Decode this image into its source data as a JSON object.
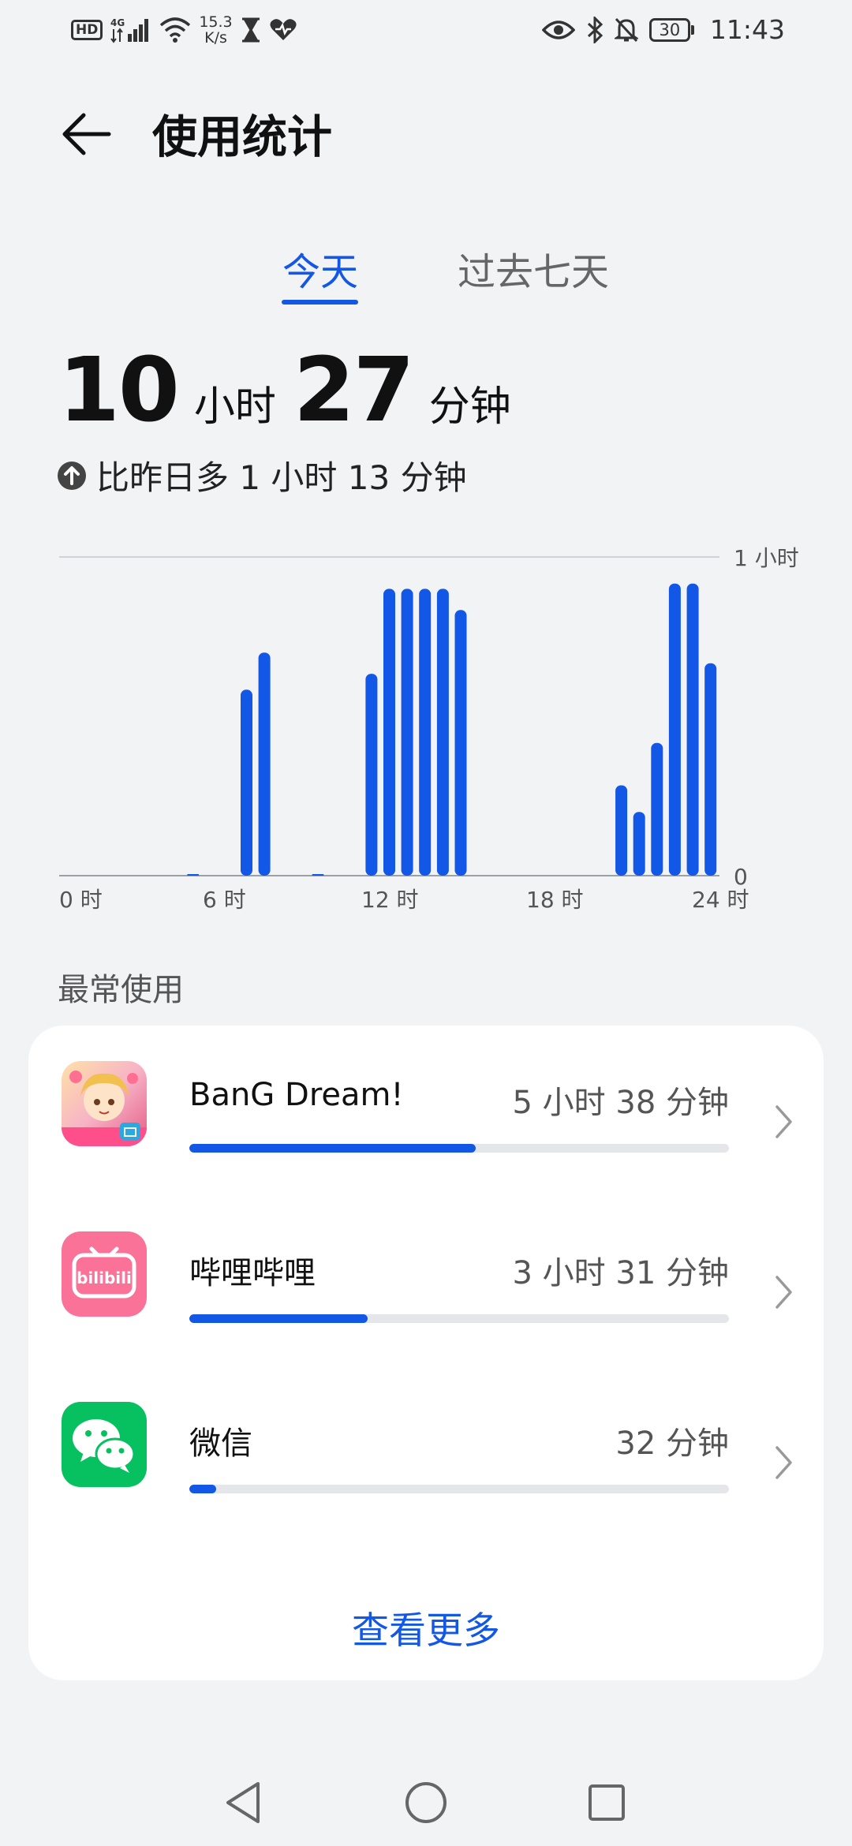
{
  "status_bar": {
    "hd": "HD",
    "net_type": "4G",
    "net_speed_value": "15.3",
    "net_speed_unit": "K/s",
    "battery": "30",
    "time": "11:43"
  },
  "header": {
    "title": "使用统计"
  },
  "tabs": [
    {
      "label": "今天",
      "selected": true
    },
    {
      "label": "过去七天",
      "selected": false
    }
  ],
  "total": {
    "hours": "10",
    "hours_unit": "小时",
    "minutes": "27",
    "minutes_unit": "分钟",
    "compare": "比昨日多 1 小时 13 分钟"
  },
  "chart_data": {
    "type": "bar",
    "unit": "minutes",
    "x_labels": [
      "0 时",
      "6 时",
      "12 时",
      "18 时",
      "24 时"
    ],
    "y_top_label": "1 小时",
    "y_bottom_label": "0",
    "ylim": [
      0,
      60
    ],
    "bar_color": "#1357e6",
    "values": [
      0,
      0,
      0,
      0,
      0,
      0,
      0,
      0.3,
      0,
      0,
      35,
      42,
      0,
      0,
      0.3,
      0,
      0,
      38,
      54,
      54,
      54,
      54,
      50,
      0,
      0,
      0,
      0,
      0,
      0,
      0,
      0,
      17,
      12,
      25,
      55,
      55,
      40
    ]
  },
  "section": {
    "title": "最常使用"
  },
  "apps": [
    {
      "name": "BanG Dream!",
      "time": "5 小时 38 分钟",
      "progress": 0.53,
      "icon": "bang-dream-icon"
    },
    {
      "name": "哔哩哔哩",
      "time": "3 小时 31 分钟",
      "progress": 0.33,
      "icon": "bilibili-icon",
      "icon_text": "bilibili"
    },
    {
      "name": "微信",
      "time": "32 分钟",
      "progress": 0.05,
      "icon": "wechat-icon"
    }
  ],
  "see_more": "查看更多",
  "colors": {
    "accent": "#1357e6",
    "background": "#f1f3f5",
    "bilibili": "#fb7299",
    "wechat": "#07c160"
  }
}
